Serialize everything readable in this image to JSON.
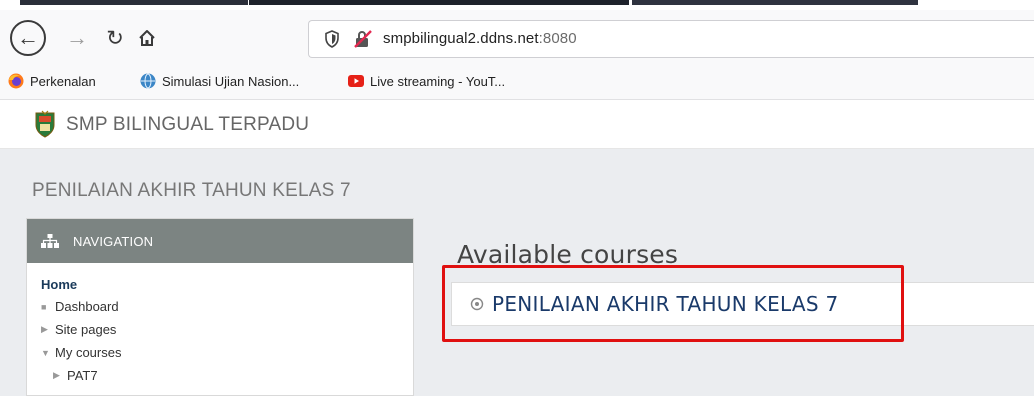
{
  "browser": {
    "url_host": "smpbilingual2.ddns.net",
    "url_port": ":8080",
    "bookmarks": [
      {
        "label": "Perkenalan",
        "icon": "firefox-icon"
      },
      {
        "label": "Simulasi Ujian Nasion...",
        "icon": "globe-icon"
      },
      {
        "label": "Live streaming - YouT...",
        "icon": "youtube-icon"
      }
    ]
  },
  "site": {
    "name": "SMP BILINGUAL TERPADU"
  },
  "page": {
    "heading": "PENILAIAN AKHIR TAHUN KELAS 7"
  },
  "navigation": {
    "title": "NAVIGATION",
    "home": "Home",
    "items": [
      {
        "label": "Dashboard",
        "marker": "bullet"
      },
      {
        "label": "Site pages",
        "marker": "collapsed"
      },
      {
        "label": "My courses",
        "marker": "expanded"
      },
      {
        "label": "PAT7",
        "marker": "collapsed",
        "level": 2
      }
    ]
  },
  "main": {
    "available_title": "Available courses",
    "courses": [
      {
        "name": "PENILAIAN AKHIR TAHUN KELAS 7"
      }
    ]
  },
  "colors": {
    "nav_header_bg": "#7c8482",
    "highlight": "#e01010",
    "link": "#1a3a6a"
  }
}
